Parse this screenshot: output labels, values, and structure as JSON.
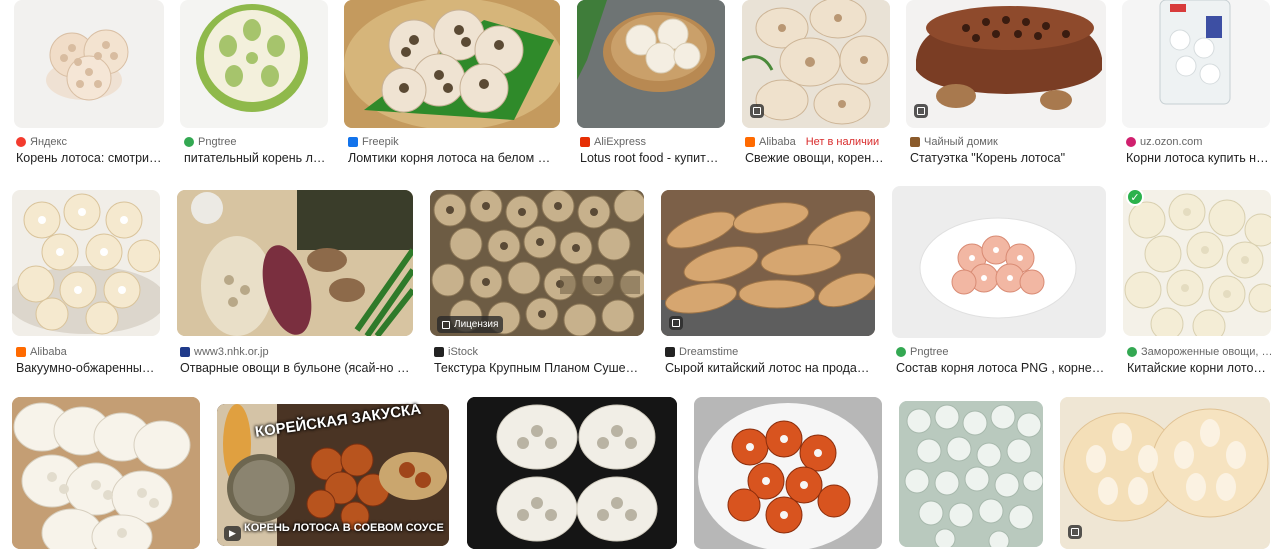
{
  "results": [
    {
      "source": "Яндекс",
      "title": "Корень лотоса: смотри…",
      "fav_color": "#f33b2e"
    },
    {
      "source": "Pngtree",
      "title": "питательный корень л…",
      "fav_color": "#33a852"
    },
    {
      "source": "Freepik",
      "title": "Ломтики корня лотоса на белом ф…",
      "fav_color": "#1273eb"
    },
    {
      "source": "AliExpress",
      "title": "Lotus root food - купит…",
      "fav_color": "#e62e04"
    },
    {
      "source": "Alibaba",
      "title": "Свежие овощи, корен…",
      "fav_color": "#ff6a00",
      "warning": "Нет в наличии"
    },
    {
      "source": "Чайный домик",
      "title": "Статуэтка \"Корень лотоса\"",
      "fav_color": "#8a5a2b"
    },
    {
      "source": "uz.ozon.com",
      "title": "Корни лотоса купить н…",
      "fav_color": "#d0206e"
    },
    {
      "source": "Alibaba",
      "title": "Вакуумно-обжаренны…",
      "fav_color": "#ff6a00"
    },
    {
      "source": "www3.nhk.or.jp",
      "title": "Отварные овощи в бульоне (ясай-но …",
      "fav_color": "#1f3a8a"
    },
    {
      "source": "iStock",
      "title": "Текстура Крупным Планом Сушен…",
      "fav_color": "#222222",
      "badge": "Лицензия"
    },
    {
      "source": "Dreamstime",
      "title": "Сырой китайский лотос на прода…",
      "fav_color": "#222222"
    },
    {
      "source": "Pngtree",
      "title": "Состав корня лотоса PNG , корне…",
      "fav_color": "#33a852"
    },
    {
      "source": "Замороженные овощи, …",
      "title": "Китайские корни лото…",
      "fav_color": "#33a852"
    }
  ],
  "overlays": {
    "korean_title": "КОРЕЙСКАЯ ЗАКУСКА",
    "korean_sub": "КОРЕНЬ ЛОТОСА В СОЕВОМ СОУСЕ"
  }
}
